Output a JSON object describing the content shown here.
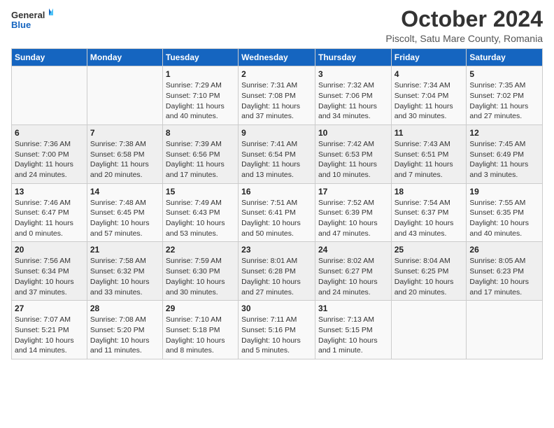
{
  "header": {
    "logo": {
      "general": "General",
      "blue": "Blue"
    },
    "title": "October 2024",
    "subtitle": "Piscolt, Satu Mare County, Romania"
  },
  "calendar": {
    "days_of_week": [
      "Sunday",
      "Monday",
      "Tuesday",
      "Wednesday",
      "Thursday",
      "Friday",
      "Saturday"
    ],
    "weeks": [
      [
        {
          "day": "",
          "info": ""
        },
        {
          "day": "",
          "info": ""
        },
        {
          "day": "1",
          "info": "Sunrise: 7:29 AM\nSunset: 7:10 PM\nDaylight: 11 hours and 40 minutes."
        },
        {
          "day": "2",
          "info": "Sunrise: 7:31 AM\nSunset: 7:08 PM\nDaylight: 11 hours and 37 minutes."
        },
        {
          "day": "3",
          "info": "Sunrise: 7:32 AM\nSunset: 7:06 PM\nDaylight: 11 hours and 34 minutes."
        },
        {
          "day": "4",
          "info": "Sunrise: 7:34 AM\nSunset: 7:04 PM\nDaylight: 11 hours and 30 minutes."
        },
        {
          "day": "5",
          "info": "Sunrise: 7:35 AM\nSunset: 7:02 PM\nDaylight: 11 hours and 27 minutes."
        }
      ],
      [
        {
          "day": "6",
          "info": "Sunrise: 7:36 AM\nSunset: 7:00 PM\nDaylight: 11 hours and 24 minutes."
        },
        {
          "day": "7",
          "info": "Sunrise: 7:38 AM\nSunset: 6:58 PM\nDaylight: 11 hours and 20 minutes."
        },
        {
          "day": "8",
          "info": "Sunrise: 7:39 AM\nSunset: 6:56 PM\nDaylight: 11 hours and 17 minutes."
        },
        {
          "day": "9",
          "info": "Sunrise: 7:41 AM\nSunset: 6:54 PM\nDaylight: 11 hours and 13 minutes."
        },
        {
          "day": "10",
          "info": "Sunrise: 7:42 AM\nSunset: 6:53 PM\nDaylight: 11 hours and 10 minutes."
        },
        {
          "day": "11",
          "info": "Sunrise: 7:43 AM\nSunset: 6:51 PM\nDaylight: 11 hours and 7 minutes."
        },
        {
          "day": "12",
          "info": "Sunrise: 7:45 AM\nSunset: 6:49 PM\nDaylight: 11 hours and 3 minutes."
        }
      ],
      [
        {
          "day": "13",
          "info": "Sunrise: 7:46 AM\nSunset: 6:47 PM\nDaylight: 11 hours and 0 minutes."
        },
        {
          "day": "14",
          "info": "Sunrise: 7:48 AM\nSunset: 6:45 PM\nDaylight: 10 hours and 57 minutes."
        },
        {
          "day": "15",
          "info": "Sunrise: 7:49 AM\nSunset: 6:43 PM\nDaylight: 10 hours and 53 minutes."
        },
        {
          "day": "16",
          "info": "Sunrise: 7:51 AM\nSunset: 6:41 PM\nDaylight: 10 hours and 50 minutes."
        },
        {
          "day": "17",
          "info": "Sunrise: 7:52 AM\nSunset: 6:39 PM\nDaylight: 10 hours and 47 minutes."
        },
        {
          "day": "18",
          "info": "Sunrise: 7:54 AM\nSunset: 6:37 PM\nDaylight: 10 hours and 43 minutes."
        },
        {
          "day": "19",
          "info": "Sunrise: 7:55 AM\nSunset: 6:35 PM\nDaylight: 10 hours and 40 minutes."
        }
      ],
      [
        {
          "day": "20",
          "info": "Sunrise: 7:56 AM\nSunset: 6:34 PM\nDaylight: 10 hours and 37 minutes."
        },
        {
          "day": "21",
          "info": "Sunrise: 7:58 AM\nSunset: 6:32 PM\nDaylight: 10 hours and 33 minutes."
        },
        {
          "day": "22",
          "info": "Sunrise: 7:59 AM\nSunset: 6:30 PM\nDaylight: 10 hours and 30 minutes."
        },
        {
          "day": "23",
          "info": "Sunrise: 8:01 AM\nSunset: 6:28 PM\nDaylight: 10 hours and 27 minutes."
        },
        {
          "day": "24",
          "info": "Sunrise: 8:02 AM\nSunset: 6:27 PM\nDaylight: 10 hours and 24 minutes."
        },
        {
          "day": "25",
          "info": "Sunrise: 8:04 AM\nSunset: 6:25 PM\nDaylight: 10 hours and 20 minutes."
        },
        {
          "day": "26",
          "info": "Sunrise: 8:05 AM\nSunset: 6:23 PM\nDaylight: 10 hours and 17 minutes."
        }
      ],
      [
        {
          "day": "27",
          "info": "Sunrise: 7:07 AM\nSunset: 5:21 PM\nDaylight: 10 hours and 14 minutes."
        },
        {
          "day": "28",
          "info": "Sunrise: 7:08 AM\nSunset: 5:20 PM\nDaylight: 10 hours and 11 minutes."
        },
        {
          "day": "29",
          "info": "Sunrise: 7:10 AM\nSunset: 5:18 PM\nDaylight: 10 hours and 8 minutes."
        },
        {
          "day": "30",
          "info": "Sunrise: 7:11 AM\nSunset: 5:16 PM\nDaylight: 10 hours and 5 minutes."
        },
        {
          "day": "31",
          "info": "Sunrise: 7:13 AM\nSunset: 5:15 PM\nDaylight: 10 hours and 1 minute."
        },
        {
          "day": "",
          "info": ""
        },
        {
          "day": "",
          "info": ""
        }
      ]
    ]
  }
}
